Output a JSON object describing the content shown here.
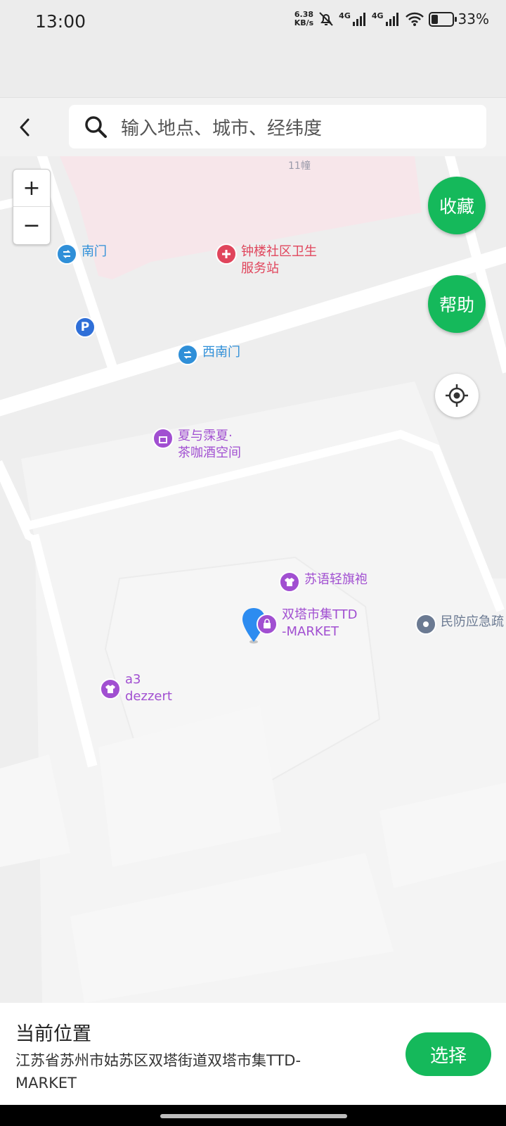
{
  "status_bar": {
    "time": "13:00",
    "speed_value": "6.38",
    "speed_unit": "KB/s",
    "network_1": "4G",
    "network_2": "4G",
    "battery": "33%",
    "battery_level": 0.33,
    "icons": [
      "mute-bell-icon",
      "signal-icon",
      "signal-icon",
      "wifi-icon",
      "battery-icon"
    ]
  },
  "search": {
    "placeholder": "输入地点、城市、经纬度"
  },
  "map": {
    "building_label": "11幢",
    "zoom_in": "+",
    "zoom_out": "−",
    "favorite_button": "收藏",
    "help_button": "帮助",
    "pois": [
      {
        "label": "南门",
        "icon": "entrance-icon",
        "color": "#2f8fd8"
      },
      {
        "label": "钟楼社区卫生\n服务站",
        "icon": "medical-cross-icon",
        "color": "#e0455c"
      },
      {
        "label": "",
        "icon": "parking-icon",
        "color": "#2f6fd8"
      },
      {
        "label": "西南门",
        "icon": "entrance-icon",
        "color": "#2f8fd8"
      },
      {
        "label": "夏与霂夏·\n茶咖酒空间",
        "icon": "shop-icon",
        "color": "#a14fd1"
      },
      {
        "label": "苏语轻旗袍",
        "icon": "clothing-icon",
        "color": "#a14fd1"
      },
      {
        "label": "双塔市集TTD\n-MARKET",
        "icon": "shopping-bag-icon",
        "color": "#a14fd1"
      },
      {
        "label": "民防应急疏",
        "icon": "dot-icon",
        "color": "#6b7a92"
      },
      {
        "label": "a3\ndezzert",
        "icon": "clothing-icon",
        "color": "#a14fd1"
      }
    ]
  },
  "location_panel": {
    "title": "当前位置",
    "address": "江苏省苏州市姑苏区双塔街道双塔市集TTD-MARKET",
    "select_button": "选择"
  },
  "colors": {
    "accent_green": "#15b95b",
    "poi_blue": "#2f8fd8",
    "poi_purple": "#a14fd1",
    "poi_red": "#e0455c",
    "pin_blue": "#2d8cf0"
  }
}
